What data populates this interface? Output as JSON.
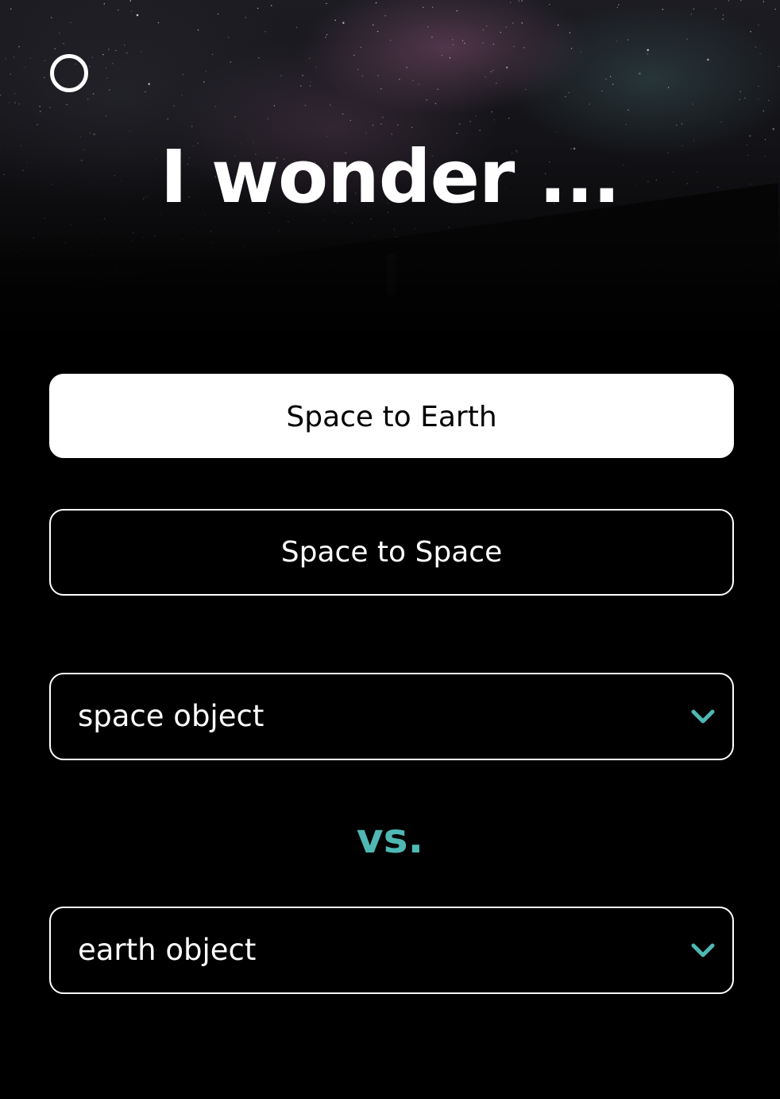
{
  "theme": {
    "accent": "#4fb8b3",
    "background": "#000000",
    "foreground": "#ffffff"
  },
  "header": {
    "logo_icon": "circle-ring-icon",
    "title": "I wonder ..."
  },
  "modes": {
    "space_to_earth_label": "Space to Earth",
    "space_to_space_label": "Space to Space",
    "active": "Space to Earth"
  },
  "compare": {
    "first_select": {
      "value": "space object",
      "icon": "chevron-down-icon"
    },
    "separator": "vs.",
    "second_select": {
      "value": "earth object",
      "icon": "chevron-down-icon"
    }
  }
}
